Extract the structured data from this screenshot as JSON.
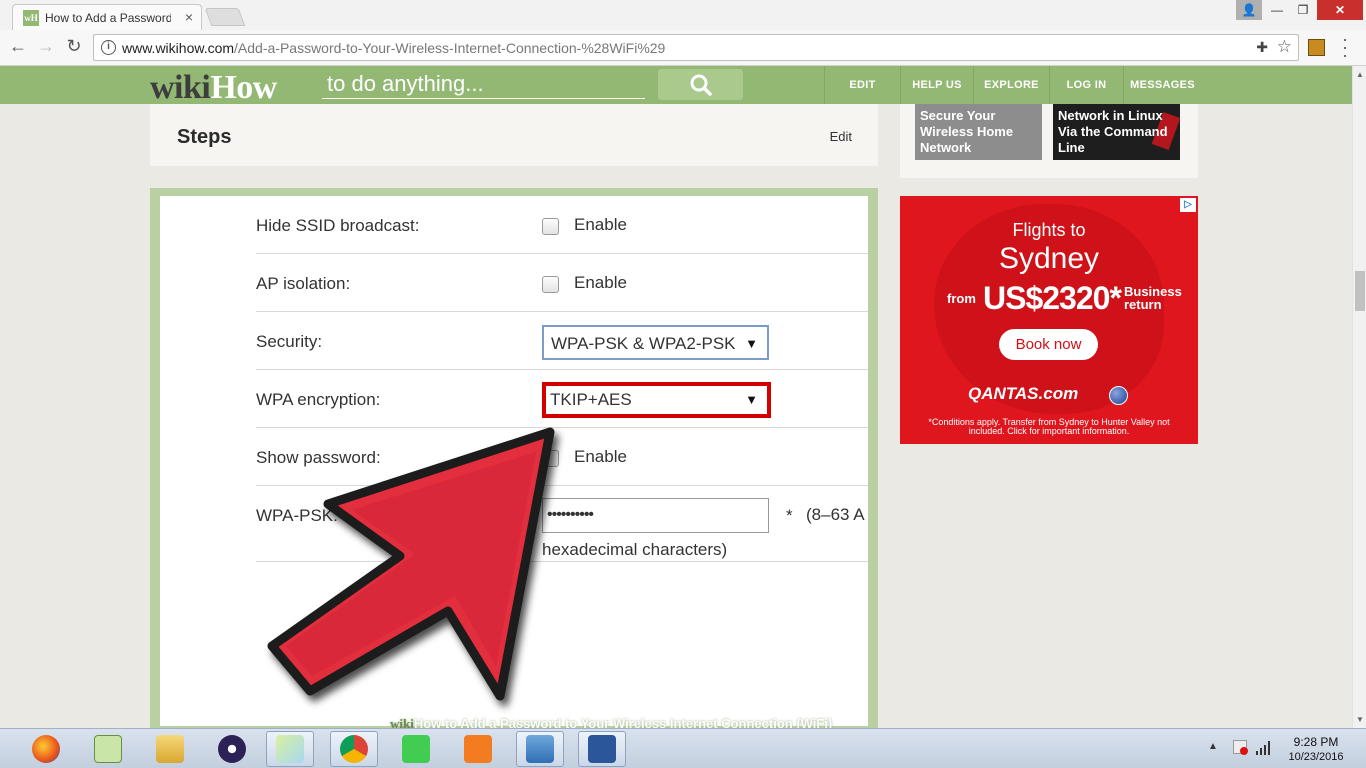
{
  "browser": {
    "tab_title": "How to Add a Password",
    "url_host": "www.wikihow.com",
    "url_path": "/Add-a-Password-to-Your-Wireless-Internet-Connection-%28WiFi%29"
  },
  "header": {
    "logo_wiki": "wiki",
    "logo_how": "How",
    "search_placeholder": "to do anything...",
    "nav": [
      "EDIT",
      "HELP US",
      "EXPLORE",
      "LOG IN",
      "MESSAGES"
    ]
  },
  "article": {
    "steps_title": "Steps",
    "edit_label": "Edit",
    "watermark_wiki": "wiki",
    "watermark_how": "How",
    "watermark_text": " to Add a Password to Your Wireless Internet Connection (WiFi)"
  },
  "router": {
    "rows": [
      {
        "label": "Hide SSID broadcast:",
        "checkbox_label": "Enable"
      },
      {
        "label": "AP isolation:",
        "checkbox_label": "Enable"
      },
      {
        "label": "Security:",
        "select_value": "WPA-PSK & WPA2-PSK"
      },
      {
        "label": "WPA encryption:",
        "select_value": "TKIP+AES"
      },
      {
        "label": "Show password:",
        "checkbox_label": "Enable"
      },
      {
        "label": "WPA-PSK:",
        "password_value": "••••••••••"
      }
    ],
    "pwd_star": "*",
    "pwd_note": "(8–63 A",
    "pwd_note2": "hexadecimal characters)"
  },
  "sidebar": {
    "related": [
      {
        "title": "Secure Your Wireless Home Network"
      },
      {
        "title": "Network in Linux Via the Command Line"
      }
    ]
  },
  "ad": {
    "line1": "Flights to",
    "line2": "Sydney",
    "from": "from",
    "price": "US$2320*",
    "business": "Business",
    "return": "return",
    "book": "Book now",
    "logo": "QANTAS.com",
    "terms": "*Conditions apply. Transfer from Sydney to Hunter Valley not included. Click for important information."
  },
  "taskbar": {
    "time": "9:28 PM",
    "date": "10/23/2016"
  },
  "colors": {
    "wikihow_green": "#93b874",
    "ad_red": "#e0161f",
    "highlight_red": "#d40000"
  }
}
